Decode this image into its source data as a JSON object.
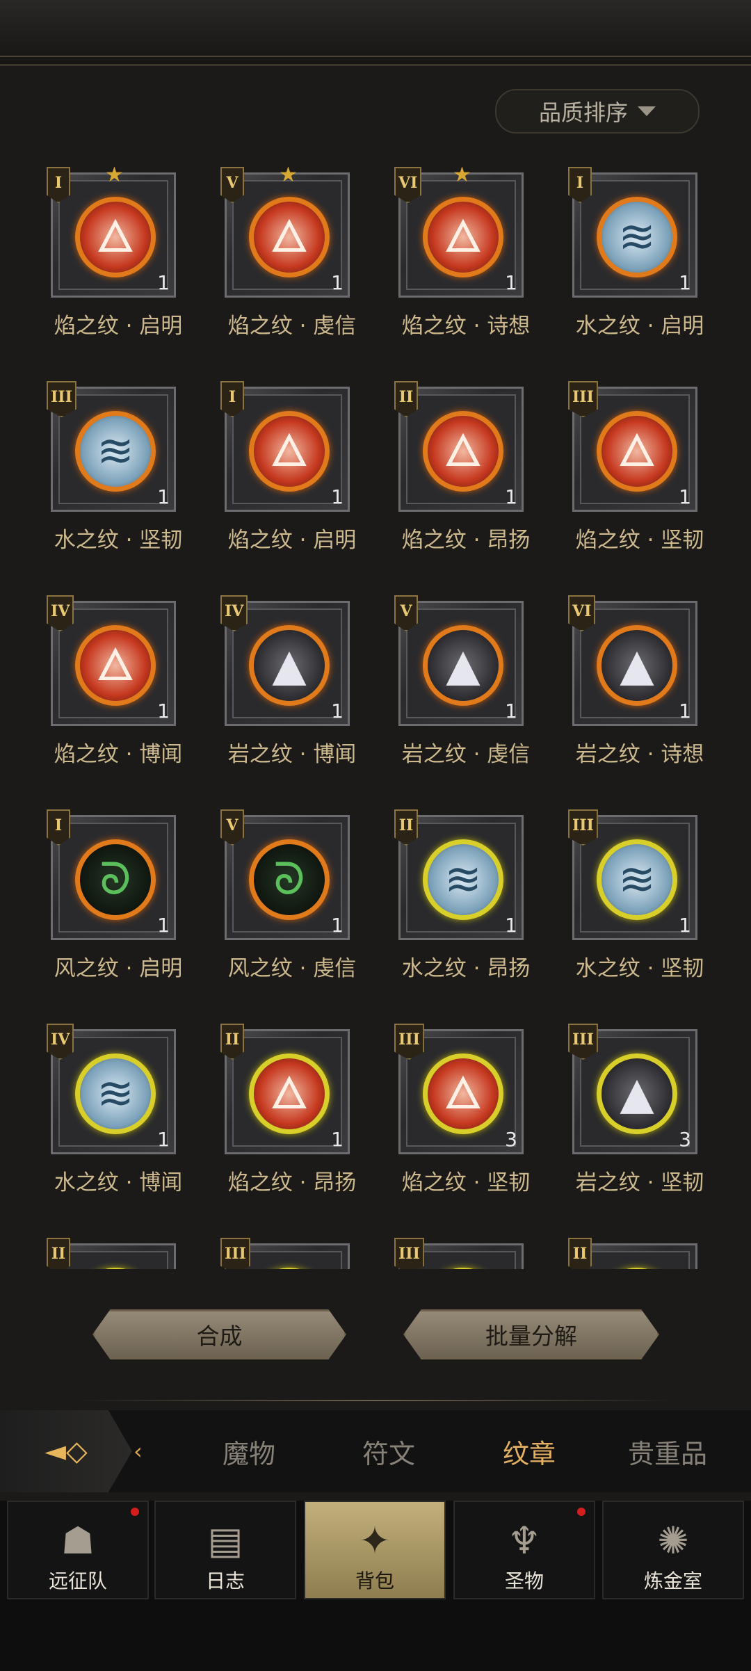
{
  "sort": {
    "label": "品质排序"
  },
  "items": [
    {
      "name": "焰之纹 · 启明",
      "tier": "I",
      "count": "1",
      "elem": "fire",
      "ring": "o",
      "star": true
    },
    {
      "name": "焰之纹 · 虔信",
      "tier": "V",
      "count": "1",
      "elem": "fire",
      "ring": "o",
      "star": true
    },
    {
      "name": "焰之纹 · 诗想",
      "tier": "VI",
      "count": "1",
      "elem": "fire",
      "ring": "o",
      "star": true
    },
    {
      "name": "水之纹 · 启明",
      "tier": "I",
      "count": "1",
      "elem": "water",
      "ring": "o",
      "star": false
    },
    {
      "name": "水之纹 · 坚韧",
      "tier": "III",
      "count": "1",
      "elem": "water",
      "ring": "o",
      "star": false
    },
    {
      "name": "焰之纹 · 启明",
      "tier": "I",
      "count": "1",
      "elem": "fire",
      "ring": "o",
      "star": false
    },
    {
      "name": "焰之纹 · 昂扬",
      "tier": "II",
      "count": "1",
      "elem": "fire",
      "ring": "o",
      "star": false
    },
    {
      "name": "焰之纹 · 坚韧",
      "tier": "III",
      "count": "1",
      "elem": "fire",
      "ring": "o",
      "star": false
    },
    {
      "name": "焰之纹 · 博闻",
      "tier": "IV",
      "count": "1",
      "elem": "fire",
      "ring": "o",
      "star": false
    },
    {
      "name": "岩之纹 · 博闻",
      "tier": "IV",
      "count": "1",
      "elem": "rock",
      "ring": "o",
      "star": false
    },
    {
      "name": "岩之纹 · 虔信",
      "tier": "V",
      "count": "1",
      "elem": "rock",
      "ring": "o",
      "star": false
    },
    {
      "name": "岩之纹 · 诗想",
      "tier": "VI",
      "count": "1",
      "elem": "rock",
      "ring": "o",
      "star": false
    },
    {
      "name": "风之纹 · 启明",
      "tier": "I",
      "count": "1",
      "elem": "wind",
      "ring": "o",
      "star": false
    },
    {
      "name": "风之纹 · 虔信",
      "tier": "V",
      "count": "1",
      "elem": "wind",
      "ring": "o",
      "star": false
    },
    {
      "name": "水之纹 · 昂扬",
      "tier": "II",
      "count": "1",
      "elem": "water",
      "ring": "y",
      "star": false
    },
    {
      "name": "水之纹 · 坚韧",
      "tier": "III",
      "count": "1",
      "elem": "water",
      "ring": "y",
      "star": false
    },
    {
      "name": "水之纹 · 博闻",
      "tier": "IV",
      "count": "1",
      "elem": "water",
      "ring": "y",
      "star": false
    },
    {
      "name": "焰之纹 · 昂扬",
      "tier": "II",
      "count": "1",
      "elem": "fire",
      "ring": "y",
      "star": false
    },
    {
      "name": "焰之纹 · 坚韧",
      "tier": "III",
      "count": "3",
      "elem": "fire",
      "ring": "y",
      "star": false
    },
    {
      "name": "岩之纹 · 坚韧",
      "tier": "III",
      "count": "3",
      "elem": "rock",
      "ring": "y",
      "star": false
    },
    {
      "name": "",
      "tier": "II",
      "count": "",
      "elem": "water",
      "ring": "y",
      "star": false
    },
    {
      "name": "",
      "tier": "III",
      "count": "",
      "elem": "water",
      "ring": "y",
      "star": false
    },
    {
      "name": "",
      "tier": "III",
      "count": "",
      "elem": "rock",
      "ring": "y",
      "star": false
    },
    {
      "name": "",
      "tier": "II",
      "count": "",
      "elem": "rock",
      "ring": "y",
      "star": false
    }
  ],
  "buttons": {
    "synthesize": "合成",
    "batch_decompose": "批量分解"
  },
  "tabs": [
    "魔物",
    "符文",
    "纹章",
    "贵重品"
  ],
  "active_tab": "纹章",
  "nav": [
    {
      "label": "远征队",
      "icon": "helmet-icon",
      "badge": true
    },
    {
      "label": "日志",
      "icon": "scroll-icon",
      "badge": false
    },
    {
      "label": "背包",
      "icon": "backpack-icon",
      "badge": false
    },
    {
      "label": "圣物",
      "icon": "chalice-icon",
      "badge": true
    },
    {
      "label": "炼金室",
      "icon": "alchemy-icon",
      "badge": false
    }
  ],
  "active_nav": "背包",
  "colors": {
    "accent": "#e3b062",
    "badge": "#d41d1d",
    "ring_orange": "#e07a1a",
    "ring_yellow": "#d8cf2a"
  }
}
